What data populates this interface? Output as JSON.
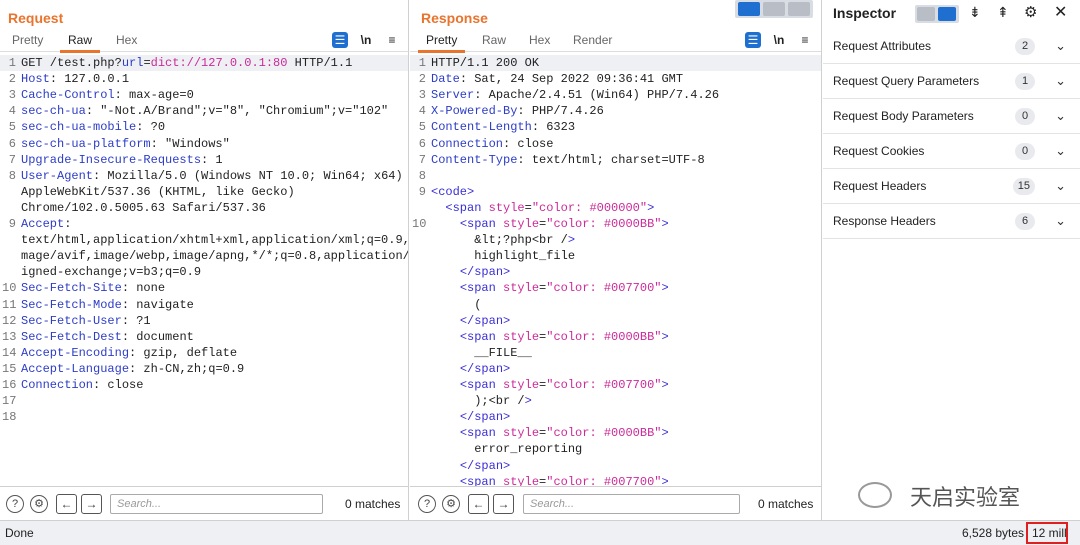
{
  "request": {
    "title": "Request",
    "tabs": [
      "Pretty",
      "Raw",
      "Hex"
    ],
    "active_tab": "Raw",
    "line_numbers": [
      "1",
      "2",
      "3",
      "4",
      "5",
      "6",
      "7",
      "8",
      "",
      "",
      "9",
      "",
      "",
      "",
      "10",
      "11",
      "12",
      "13",
      "14",
      "15",
      "16",
      "17",
      "18"
    ],
    "lines": [
      "GET /test.php?url=dict://127.0.0.1:80 HTTP/1.1",
      "Host: 127.0.0.1",
      "Cache-Control: max-age=0",
      "sec-ch-ua: \"-Not.A/Brand\";v=\"8\", \"Chromium\";v=\"102\"",
      "sec-ch-ua-mobile: ?0",
      "sec-ch-ua-platform: \"Windows\"",
      "Upgrade-Insecure-Requests: 1",
      "User-Agent: Mozilla/5.0 (Windows NT 10.0; Win64; x64)",
      "AppleWebKit/537.36 (KHTML, like Gecko)",
      "Chrome/102.0.5005.63 Safari/537.36",
      "Accept:",
      "text/html,application/xhtml+xml,application/xml;q=0.9,i",
      "mage/avif,image/webp,image/apng,*/*;q=0.8,application/s",
      "igned-exchange;v=b3;q=0.9",
      "Sec-Fetch-Site: none",
      "Sec-Fetch-Mode: navigate",
      "Sec-Fetch-User: ?1",
      "Sec-Fetch-Dest: document",
      "Accept-Encoding: gzip, deflate",
      "Accept-Language: zh-CN,zh;q=0.9",
      "Connection: close",
      "",
      ""
    ],
    "search_placeholder": "Search...",
    "matches": "0 matches"
  },
  "response": {
    "title": "Response",
    "tabs": [
      "Pretty",
      "Raw",
      "Hex",
      "Render"
    ],
    "active_tab": "Pretty",
    "line_numbers": [
      "1",
      "2",
      "3",
      "4",
      "5",
      "6",
      "7",
      "8",
      "9",
      "",
      "10",
      "",
      "",
      "",
      "",
      "",
      "",
      "",
      "",
      "",
      "",
      "",
      "",
      "",
      ""
    ],
    "lines": [
      "HTTP/1.1 200 OK",
      "Date: Sat, 24 Sep 2022 09:36:41 GMT",
      "Server: Apache/2.4.51 (Win64) PHP/7.4.26",
      "X-Powered-By: PHP/7.4.26",
      "Content-Length: 6323",
      "Connection: close",
      "Content-Type: text/html; charset=UTF-8",
      "",
      "<code>",
      "  <span style=\"color: #000000\">",
      "    <span style=\"color: #0000BB\">",
      "      &lt;?php<br />",
      "      highlight_file",
      "    </span>",
      "    <span style=\"color: #007700\">",
      "      (",
      "    </span>",
      "    <span style=\"color: #0000BB\">",
      "      __FILE__",
      "    </span>",
      "    <span style=\"color: #007700\">",
      "      );<br />",
      "    </span>",
      "    <span style=\"color: #0000BB\">",
      "      error_reporting",
      "    </span>",
      "    <span style=\"color: #007700\">"
    ],
    "search_placeholder": "Search...",
    "matches": "0 matches"
  },
  "inspector": {
    "title": "Inspector",
    "rows": [
      {
        "label": "Request Attributes",
        "count": "2"
      },
      {
        "label": "Request Query Parameters",
        "count": "1"
      },
      {
        "label": "Request Body Parameters",
        "count": "0"
      },
      {
        "label": "Request Cookies",
        "count": "0"
      },
      {
        "label": "Request Headers",
        "count": "15"
      },
      {
        "label": "Response Headers",
        "count": "6"
      }
    ]
  },
  "status": {
    "left": "Done",
    "bytes": "6,528 bytes",
    "millis": "12 millis",
    "highlight_color": "#e02020"
  },
  "watermark": "天启实验室",
  "colors": {
    "accent": "#e8742e",
    "header_key": "#2d3dc6",
    "tag": "#3a2fd4",
    "attr_val": "#cc2a9a"
  }
}
